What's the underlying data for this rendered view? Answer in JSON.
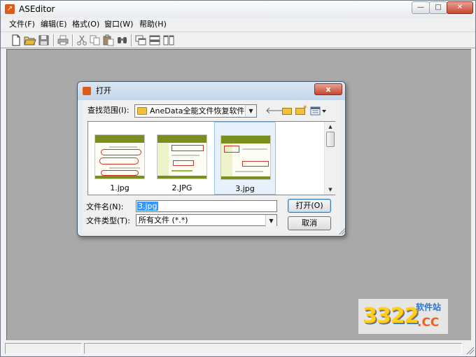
{
  "window": {
    "title": "ASEditor"
  },
  "menu": {
    "items": [
      {
        "label": "文件(F)"
      },
      {
        "label": "编辑(E)"
      },
      {
        "label": "格式(O)"
      },
      {
        "label": "窗口(W)"
      },
      {
        "label": "帮助(H)"
      }
    ]
  },
  "toolbar": {
    "buttons": [
      "new-file",
      "open-file",
      "save",
      "print",
      "cut",
      "copy",
      "paste",
      "find",
      "tile-cascade",
      "tile-horizontal",
      "tile-vertical"
    ]
  },
  "dialog": {
    "title": "打开",
    "close_label": "x",
    "look_in_label": "查找范围(I):",
    "look_in_value": "AneData全能文件恢复软件",
    "files": [
      {
        "name": "1.jpg",
        "selected": false
      },
      {
        "name": "2.JPG",
        "selected": false
      },
      {
        "name": "3.jpg",
        "selected": true
      }
    ],
    "filename_label": "文件名(N):",
    "filename_value": "3.jpg",
    "filetype_label": "文件类型(T):",
    "filetype_value": "所有文件 (*.*)",
    "open_button": "打开(O)",
    "cancel_button": "取消"
  },
  "watermark": {
    "number": "3322",
    "cc": ".CC",
    "site": "软件站"
  },
  "colors": {
    "workspace": "#a9a9a9",
    "dialog_frame": "#e7edf4",
    "close_red": "#c8452f",
    "selection": "#3399ff"
  }
}
